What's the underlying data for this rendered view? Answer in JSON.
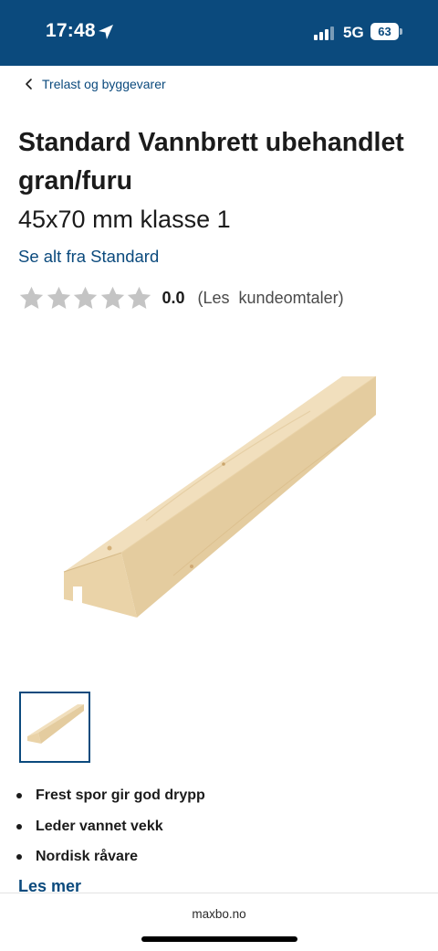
{
  "status_bar": {
    "time": "17:48",
    "network": "5G",
    "battery": "63",
    "icons": [
      "location-arrow-icon",
      "signal-bars-icon",
      "battery-icon"
    ]
  },
  "breadcrumb": {
    "label": "Trelast og byggevarer",
    "icon": "chevron-left-icon"
  },
  "product": {
    "title": "Standard Vannbrett ubehandlet gran/furu",
    "subtitle": "45x70 mm klasse 1",
    "brand_link": "Se alt fra Standard"
  },
  "rating": {
    "value": "0.0",
    "note": "(Les  kundeomtaler)",
    "stars_filled": 0,
    "stars_total": 5
  },
  "features": [
    "Frest spor gir god drypp",
    "Leder vannet vekk",
    "Nordisk råvare"
  ],
  "read_more": "Les mer",
  "browser": {
    "url": "maxbo.no"
  },
  "colors": {
    "brand_blue": "#0b4a7d",
    "star_empty": "#c4c4c4",
    "wood_light": "#f1dfbd",
    "wood_side": "#e2c99c"
  }
}
